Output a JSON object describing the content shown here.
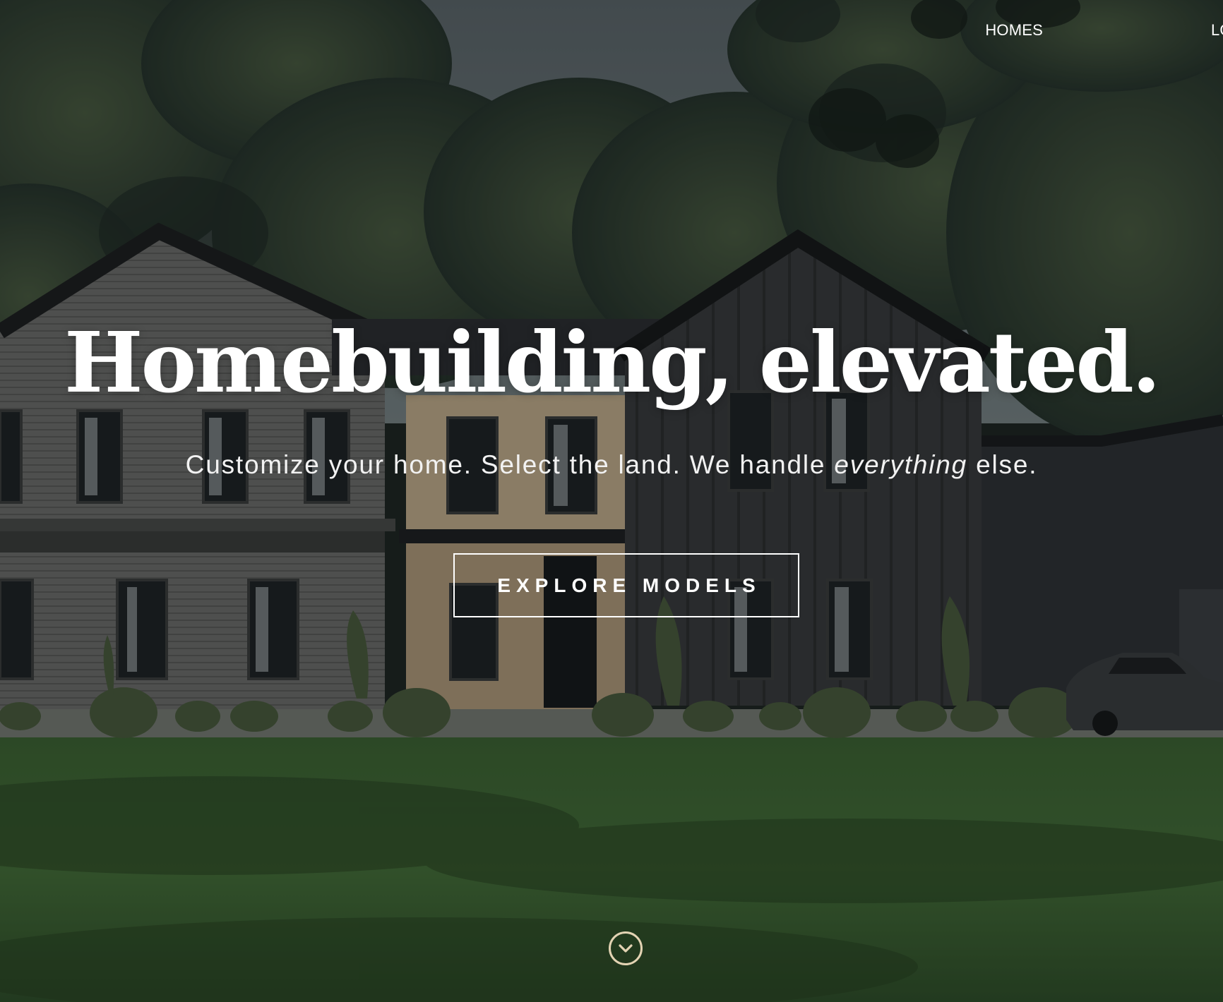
{
  "nav": {
    "items": [
      {
        "label": "HOMES"
      },
      {
        "label": "LOCATI"
      }
    ]
  },
  "hero": {
    "headline": "Homebuilding, elevated.",
    "subhead_start": "Customize your home. Select the land. We handle ",
    "subhead_emphasis": "everything",
    "subhead_end": " else.",
    "cta_label": "EXPLORE MODELS",
    "scroll_icon": "chevron-down-circle-icon"
  },
  "colors": {
    "text": "#ffffff",
    "scroll_accent": "#e3d3b3",
    "lawn": "#3f6b35",
    "siding_dark": "#3a3a3c",
    "siding_gray": "#6e6c6c"
  }
}
